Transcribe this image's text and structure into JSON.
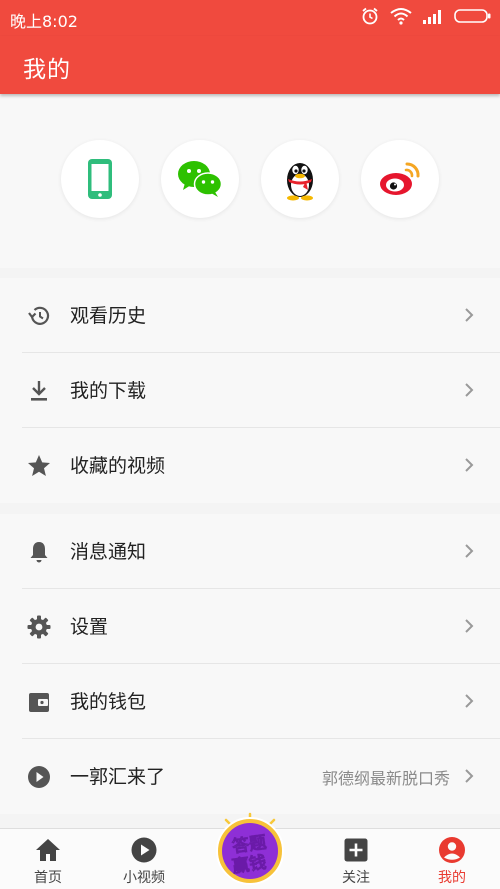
{
  "status": {
    "time": "晚上8:02"
  },
  "header": {
    "title": "我的"
  },
  "login": {
    "options": [
      {
        "name": "phone"
      },
      {
        "name": "wechat"
      },
      {
        "name": "qq"
      },
      {
        "name": "weibo"
      }
    ]
  },
  "menu_group1": [
    {
      "label": "观看历史",
      "icon": "history-icon"
    },
    {
      "label": "我的下载",
      "icon": "download-icon"
    },
    {
      "label": "收藏的视频",
      "icon": "star-icon"
    }
  ],
  "menu_group2": [
    {
      "label": "消息通知",
      "icon": "bell-icon"
    },
    {
      "label": "设置",
      "icon": "gear-icon"
    },
    {
      "label": "我的钱包",
      "icon": "wallet-icon"
    },
    {
      "label": "一郭汇来了",
      "icon": "play-circle-icon",
      "sub": "郭德纲最新脱口秀"
    }
  ],
  "tabbar": {
    "tabs": [
      {
        "label": "首页",
        "icon": "home-icon"
      },
      {
        "label": "小视频",
        "icon": "play-icon"
      },
      {
        "label": "关注",
        "icon": "plus-box-icon"
      },
      {
        "label": "我的",
        "icon": "user-icon",
        "active": true
      }
    ],
    "badge": {
      "line1": "答题",
      "line2": "赢钱"
    }
  },
  "colors": {
    "accent": "#f04a3e",
    "active_tab": "#e93a30",
    "icon_gray": "#555555"
  }
}
